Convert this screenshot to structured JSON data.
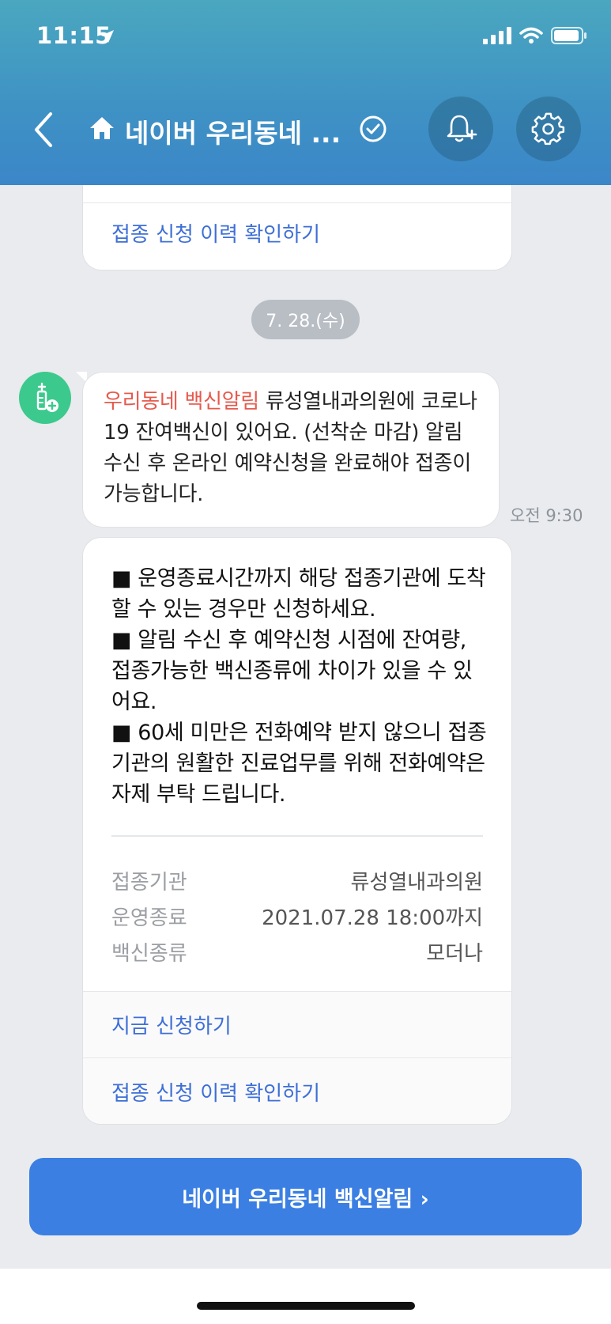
{
  "status_bar": {
    "time": "11:15"
  },
  "header": {
    "title": "네이버 우리동네 ..."
  },
  "top_card": {
    "link_label": "접종 신청 이력 확인하기"
  },
  "date_divider": "7. 28.(수)",
  "message": {
    "tag": "우리동네 백신알림",
    "body": " 류성열내과의원에 코로나19 잔여백신이 있어요. (선착순 마감) 알림 수신 후 온라인 예약신청을 완료해야 접종이 가능합니다.",
    "time": "오전 9:30"
  },
  "info_card": {
    "notes": [
      "■ 운영종료시간까지 해당 접종기관에 도착할 수 있는 경우만 신청하세요.",
      "■ 알림 수신 후 예약신청 시점에 잔여량, 접종가능한 백신종류에 차이가 있을 수 있어요.",
      "■ 60세 미만은 전화예약 받지 않으니 접종기관의 원활한 진료업무를 위해 전화예약은 자제 부탁 드립니다."
    ],
    "rows": [
      {
        "key": "접종기관",
        "value": "류성열내과의원"
      },
      {
        "key": "운영종료",
        "value": "2021.07.28 18:00까지"
      },
      {
        "key": "백신종류",
        "value": "모더나"
      }
    ],
    "apply_now_label": "지금 신청하기",
    "history_label": "접종 신청 이력 확인하기"
  },
  "main_button": {
    "label": "네이버 우리동네 백신알림 ›"
  },
  "colors": {
    "accent": "#3b7fe3",
    "link": "#3e6fd6",
    "tag": "#e55a4d",
    "header": "#4aa7bf"
  }
}
